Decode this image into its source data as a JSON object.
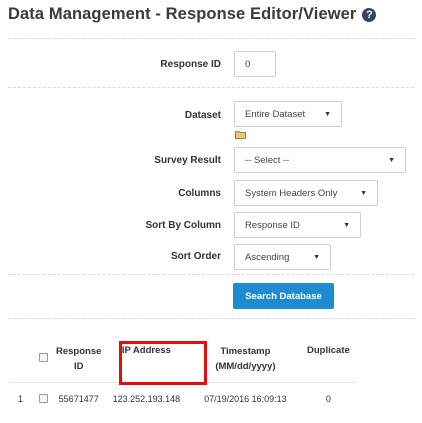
{
  "header": {
    "title": "Data Management - Response Editor/Viewer",
    "help_icon": "question-circle-icon"
  },
  "form": {
    "response_id": {
      "label": "Response ID",
      "value": "0"
    },
    "dataset": {
      "label": "Dataset",
      "value": "Entire Dataset"
    },
    "survey_result": {
      "label": "Survey Result",
      "value": "-- Select --"
    },
    "columns": {
      "label": "Columns",
      "value": "System Headers Only"
    },
    "sort_by_column": {
      "label": "Sort By Column",
      "value": "Response ID"
    },
    "sort_order": {
      "label": "Sort Order",
      "value": "Ascending"
    },
    "folder_icon": "folder-icon"
  },
  "search_button": {
    "label": "Search Database",
    "color": "#1e8bd1"
  },
  "table": {
    "headers": {
      "response_id_line1": "Response",
      "response_id_line2": "ID",
      "ip_address": "IP Address",
      "timestamp_line1": "Timestamp",
      "timestamp_line2": "(MM/dd/yyyy)",
      "duplicate": "Duplicate"
    },
    "rows": [
      {
        "index": "1",
        "response_id": "55671477",
        "ip_address": "123.252.193.148",
        "timestamp": "07/19/2016 16:09:13",
        "duplicate": "0"
      }
    ]
  },
  "highlight_color": "#e20e0e"
}
